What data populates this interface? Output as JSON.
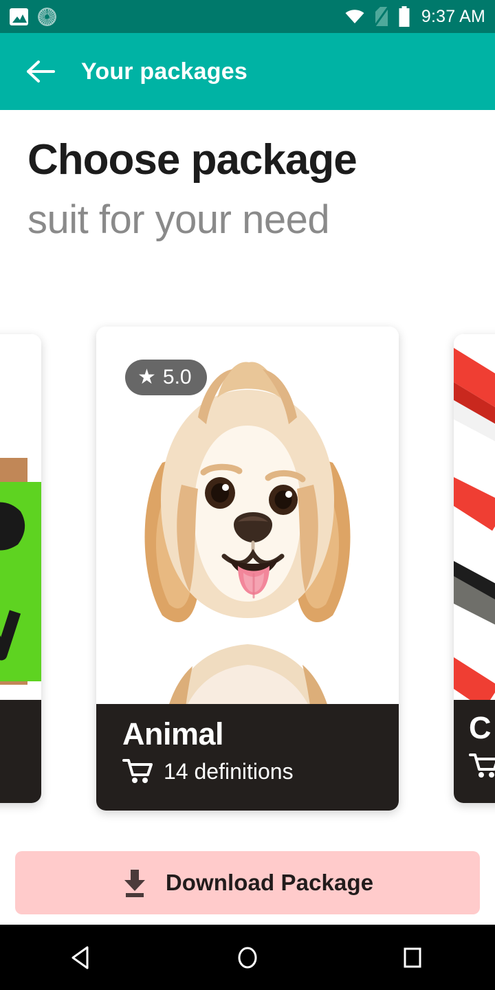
{
  "status_bar": {
    "time": "9:37 AM",
    "left_icons": [
      "photo-icon",
      "sync-progress-icon"
    ],
    "right_icons": [
      "wifi-icon",
      "sim-off-icon",
      "battery-icon"
    ],
    "background": "#00796b"
  },
  "app_bar": {
    "title": "Your packages",
    "back_icon": "back-arrow-icon",
    "background": "#00b3a4",
    "text_color": "#ffffff"
  },
  "headings": {
    "title": "Choose package",
    "subtitle": "suit for your need",
    "title_color": "#1c1c1c",
    "subtitle_color": "#8a8a8a"
  },
  "carousel": {
    "cards": [
      {
        "id": "left",
        "title": "",
        "meta": "",
        "rating": "",
        "accent": "#7dd628"
      },
      {
        "id": "center",
        "title": "Animal",
        "meta": "14 definitions",
        "rating": "5.0",
        "rating_icon": "star-icon",
        "meta_icon": "cart-icon",
        "label_background": "#231f1d"
      },
      {
        "id": "right",
        "title": "C",
        "meta": "",
        "rating": "",
        "meta_icon": "cart-icon",
        "accent": "#e8352b"
      }
    ]
  },
  "download_button": {
    "label": "Download Package",
    "icon": "download-icon",
    "background": "#FFCBCB",
    "text_color": "#221c1c"
  },
  "nav_bar": {
    "back": "back-triangle-icon",
    "home": "home-circle-icon",
    "recents": "recents-square-icon",
    "background": "#000000"
  }
}
